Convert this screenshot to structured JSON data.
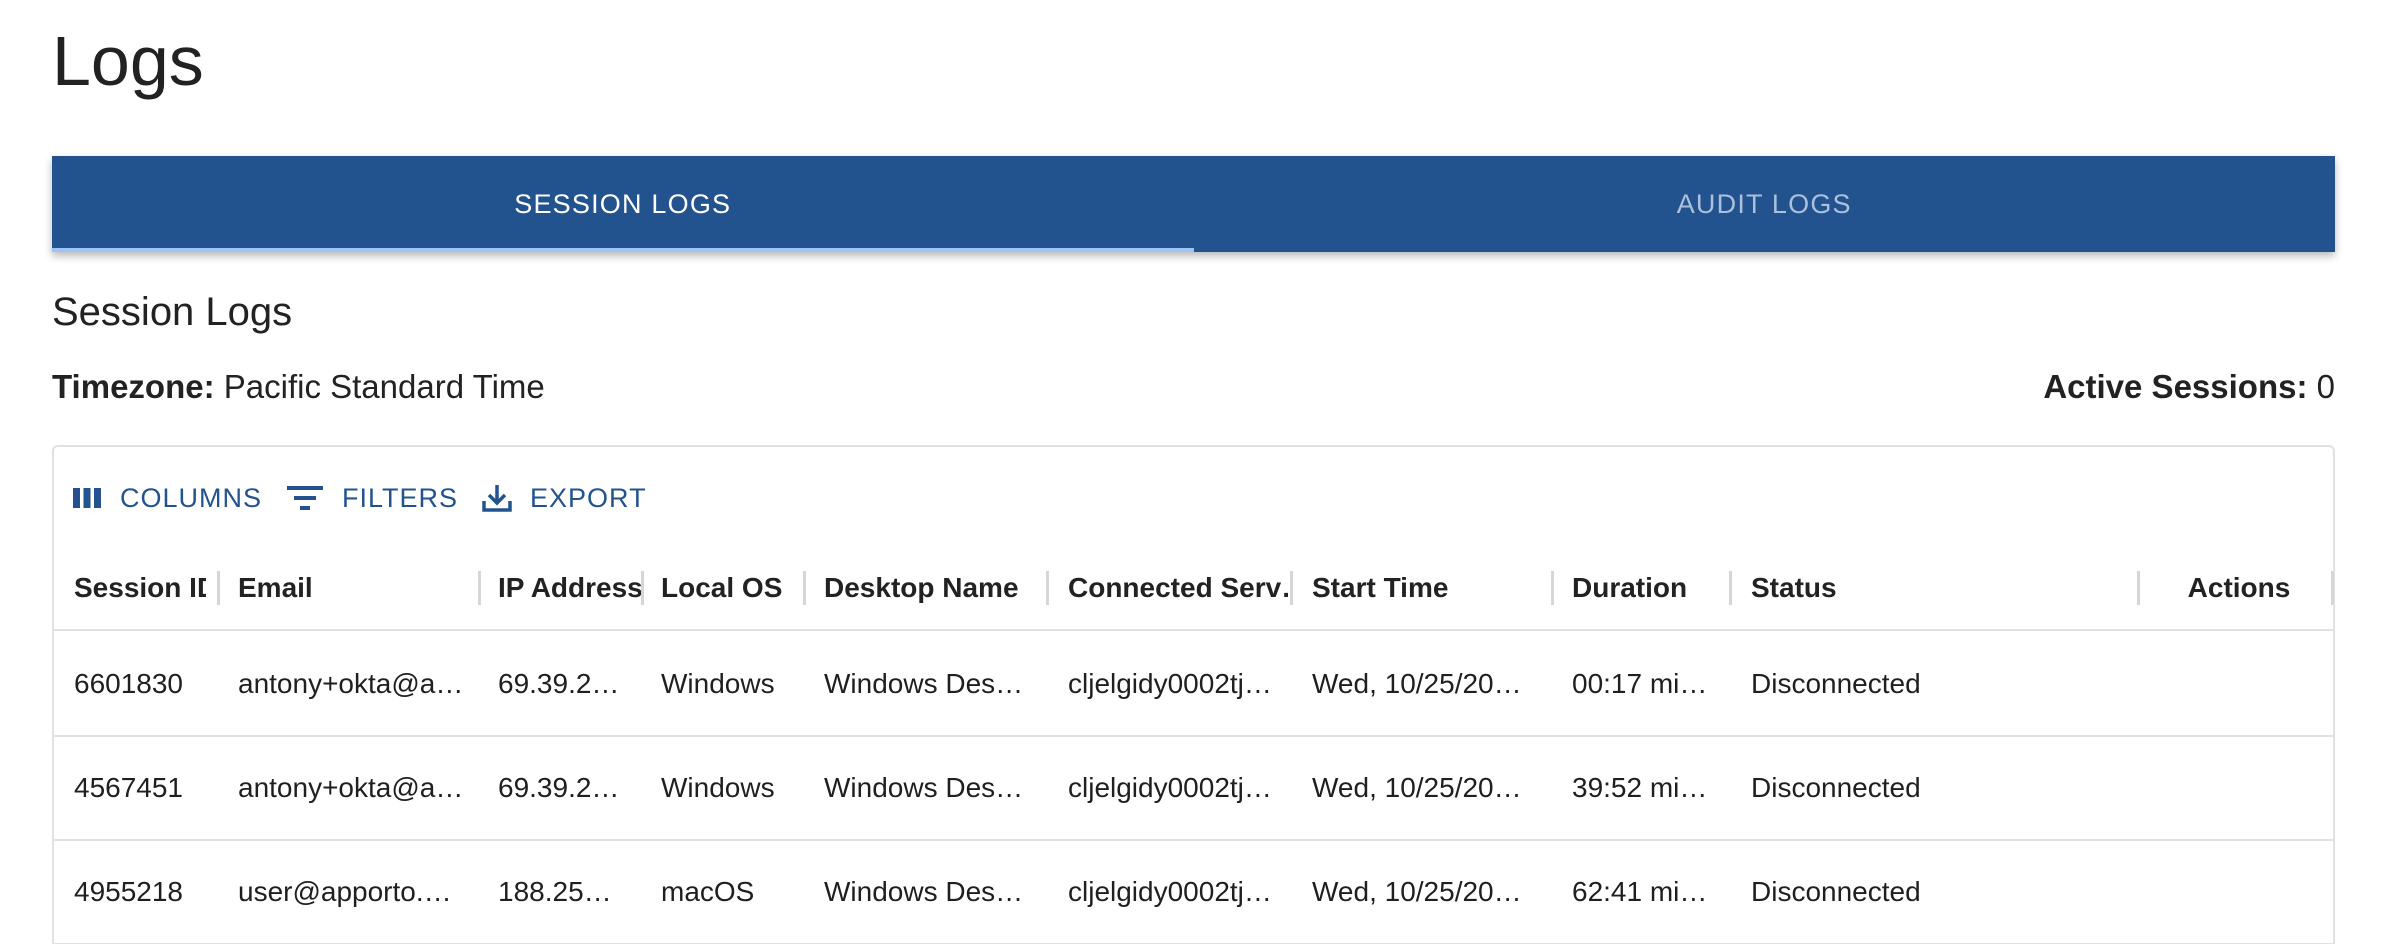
{
  "page": {
    "title": "Logs"
  },
  "tabs": [
    {
      "label": "SESSION LOGS",
      "active": true
    },
    {
      "label": "AUDIT LOGS",
      "active": false
    }
  ],
  "section": {
    "title": "Session Logs",
    "timezone_label": "Timezone:",
    "timezone_value": "Pacific Standard Time",
    "active_label": "Active Sessions:",
    "active_value": "0"
  },
  "toolbar": {
    "columns_label": "COLUMNS",
    "filters_label": "FILTERS",
    "export_label": "EXPORT"
  },
  "table": {
    "columns": [
      "Session ID",
      "Email",
      "IP Address",
      "Local OS",
      "Desktop Name",
      "Connected Serv…",
      "Start Time",
      "Duration",
      "Status",
      "Actions"
    ],
    "rows": [
      [
        "6601830",
        "antony+okta@a…",
        "69.39.2…",
        "Windows",
        "Windows Des…",
        "cljelgidy0002tj…",
        "Wed, 10/25/20…",
        "00:17 mi…",
        "Disconnected",
        ""
      ],
      [
        "4567451",
        "antony+okta@a…",
        "69.39.2…",
        "Windows",
        "Windows Des…",
        "cljelgidy0002tj…",
        "Wed, 10/25/20…",
        "39:52 mi…",
        "Disconnected",
        ""
      ],
      [
        "4955218",
        "user@apporto.…",
        "188.25…",
        "macOS",
        "Windows Des…",
        "cljelgidy0002tj…",
        "Wed, 10/25/20…",
        "62:41 mi…",
        "Disconnected",
        ""
      ]
    ]
  },
  "colors": {
    "primary": "#22538f",
    "tab_indicator": "#9dc4f5",
    "inactive_tab_text": "#aac0dc",
    "border": "#e1e1e1"
  },
  "icons": {
    "columns": "view-column-icon",
    "filters": "filter-list-icon",
    "export": "download-icon"
  }
}
